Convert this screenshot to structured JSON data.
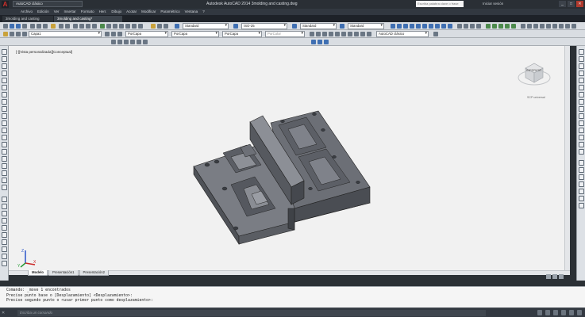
{
  "titlebar": {
    "qat_label": "AutoCAD clásico",
    "app_title": "Autodesk AutoCAD 2014   3molding and casting.dwg",
    "search_placeholder": "Escriba palabra clave o frase",
    "signin": "Iniciar sesión",
    "min": "_",
    "max": "□",
    "close": "✕"
  },
  "menu": [
    "Archivo",
    "Edición",
    "Ver",
    "Insertar",
    "Formato",
    "Herr.",
    "Dibujo",
    "Acotar",
    "Modificar",
    "Paramétrico",
    "Ventana",
    "?"
  ],
  "doctabs": [
    "3molding and casting",
    "3molding and casting*"
  ],
  "toolbar": {
    "layer": "Capa1",
    "color": "PorCapa",
    "linetype1": "PorCapa",
    "linetype2": "PorCapa",
    "plotstyle": "PorColor",
    "textstyle": "Standard",
    "dimstyle": "ISO-25",
    "tablestyle": "Standard",
    "mleaderstyle": "Standard",
    "workspace": "AutoCAD clásico"
  },
  "viewport_label": "[-][Vista personalizada][Conceptual]",
  "viewcube": {
    "face": "INFERIOR",
    "wcs": "SCP universal"
  },
  "layout_tabs": [
    "Modelo",
    "Presentación1",
    "Presentación2"
  ],
  "command_history": [
    "Comando: _move 1 encontrados",
    "Precise punto base o [Desplazamiento] <Desplazamiento>:",
    "Precise segundo punto o <usar primer punto como desplazamiento>:"
  ],
  "command_placeholder": "Escriba un comando",
  "ucs": {
    "x": "X",
    "y": "Y",
    "z": "Z"
  }
}
